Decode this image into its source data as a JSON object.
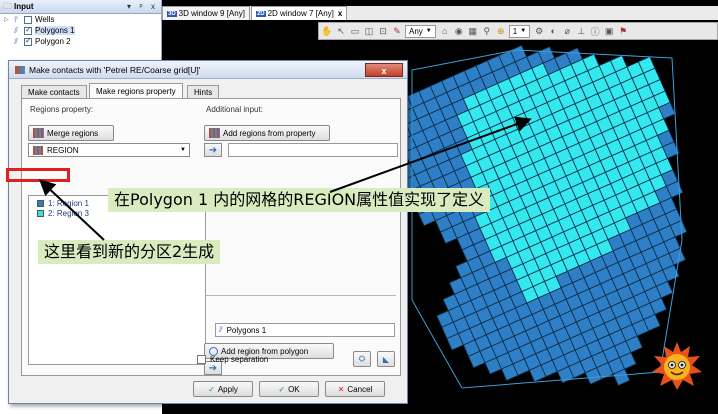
{
  "input_panel": {
    "title": "Input",
    "header_buttons": [
      "▾",
      "ᵖ",
      "x"
    ],
    "tree": [
      {
        "label": "Wells",
        "checked": false,
        "icon": "wells-icon"
      },
      {
        "label": "Polygons 1",
        "checked": true,
        "icon": "polygon-icon",
        "selected": true
      },
      {
        "label": "Polygon 2",
        "checked": true,
        "icon": "polygon-icon"
      }
    ]
  },
  "view_tabs": [
    {
      "badge": "3D",
      "label": "3D window 9 [Any]"
    },
    {
      "badge": "2D",
      "label": "2D window 7 [Any]",
      "close": "x",
      "active": true
    }
  ],
  "toolbar": {
    "filter_value": "Any",
    "zoom_value": "1"
  },
  "dialog": {
    "title": "Make contacts with 'Petrel RE/Coarse grid[U]'",
    "close_label": "x",
    "tabs": [
      "Make contacts",
      "Make regions property",
      "Hints"
    ],
    "regions_property_label": "Regions property:",
    "merge_regions_label": "Merge regions",
    "region_combo_value": "REGION",
    "regions": [
      {
        "label": "1: Region 1",
        "color": "#2e7fc6"
      },
      {
        "label": "2: Region 3",
        "color": "#33e0e0"
      }
    ],
    "additional_input_label": "Additional input:",
    "add_from_property_label": "Add regions from property",
    "add_from_polygon_label": "Add region from polygon",
    "polygon_value": "Polygons 1",
    "keep_separation_label": "Keep separation",
    "apply_label": "Apply",
    "ok_label": "OK",
    "cancel_label": "Cancel"
  },
  "annotations": {
    "grid_note": "在Polygon 1 内的网格的REGION属性值实现了定义",
    "region_note": "这里看到新的分区2生成"
  },
  "colors": {
    "region_dark": "#2e7fc6",
    "region_light": "#33e8ee",
    "annotation_bg": "#d8ecc0",
    "highlight_red": "#e02020"
  }
}
